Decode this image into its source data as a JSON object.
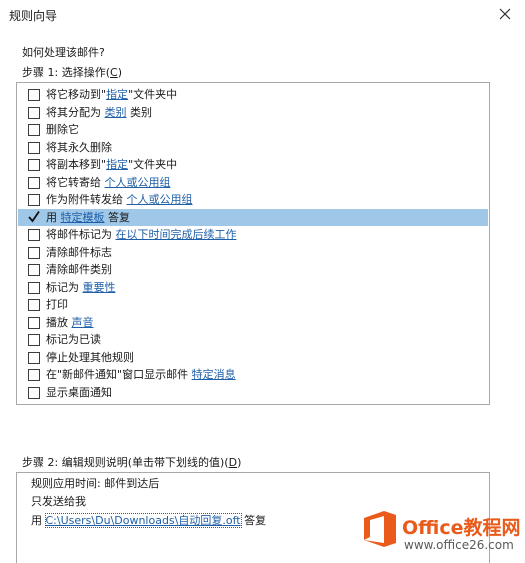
{
  "window": {
    "title": "规则向导"
  },
  "prompt": "如何处理该邮件?",
  "step1": {
    "label": "步骤 1: 选择操作(",
    "accel": "C",
    "label_end": ")",
    "actions": [
      {
        "text": "将它移动到\"",
        "link": "指定",
        "after": "\"文件夹中",
        "checked": false
      },
      {
        "text": "将其分配为 ",
        "link": "类别",
        "after": " 类别",
        "checked": false
      },
      {
        "text": "删除它",
        "link": "",
        "after": "",
        "checked": false
      },
      {
        "text": "将其永久删除",
        "link": "",
        "after": "",
        "checked": false
      },
      {
        "text": "将副本移到\"",
        "link": "指定",
        "after": "\"文件夹中",
        "checked": false
      },
      {
        "text": "将它转寄给 ",
        "link": "个人或公用组",
        "after": "",
        "checked": false
      },
      {
        "text": "作为附件转发给 ",
        "link": "个人或公用组",
        "after": "",
        "checked": false
      },
      {
        "text": "用 ",
        "link": "特定模板",
        "after": " 答复",
        "checked": true
      },
      {
        "text": "将邮件标记为 ",
        "link": "在以下时间完成后续工作",
        "after": "",
        "checked": false
      },
      {
        "text": "清除邮件标志",
        "link": "",
        "after": "",
        "checked": false
      },
      {
        "text": "清除邮件类别",
        "link": "",
        "after": "",
        "checked": false
      },
      {
        "text": "标记为 ",
        "link": "重要性",
        "after": "",
        "checked": false
      },
      {
        "text": "打印",
        "link": "",
        "after": "",
        "checked": false
      },
      {
        "text": "播放 ",
        "link": "声音",
        "after": "",
        "checked": false
      },
      {
        "text": "标记为已读",
        "link": "",
        "after": "",
        "checked": false
      },
      {
        "text": "停止处理其他规则",
        "link": "",
        "after": "",
        "checked": false
      },
      {
        "text": "在\"新邮件通知\"窗口显示邮件 ",
        "link": "特定消息",
        "after": "",
        "checked": false
      },
      {
        "text": "显示桌面通知",
        "link": "",
        "after": "",
        "checked": false
      }
    ]
  },
  "step2": {
    "label": "步骤 2: 编辑规则说明(单击带下划线的值)(",
    "accel": "D",
    "label_end": ")",
    "line1": "规则应用时间: 邮件到达后",
    "line2": "只发送给我",
    "line3_prefix": "用 ",
    "line3_link": "C:\\Users\\Du\\Downloads\\自动回复.oft",
    "line3_suffix": " 答复"
  },
  "watermark": {
    "title": "Office教程网",
    "url": "www.office26.com"
  },
  "colors": {
    "selection": "#9fc7e7",
    "link": "#1f5fa8",
    "brand": "#ea5b1b"
  }
}
